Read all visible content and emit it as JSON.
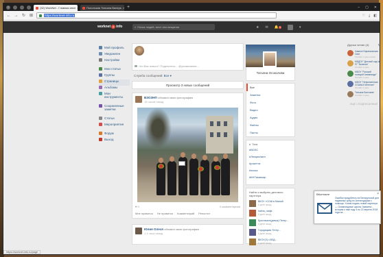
{
  "browser": {
    "tabs": [
      {
        "label": "(32) WorkNet - Главная инсп",
        "active": true
      },
      {
        "label": "Полонская Татьяна Валерь",
        "active": false
      }
    ],
    "url": "https://worknet-info.ru",
    "status_text": "https://worknet-info.ru/page"
  },
  "header": {
    "logo_text": "worknet",
    "logo_suffix": "info",
    "search_placeholder": "Поиск людей, мест или вещания",
    "notif_badge": "3"
  },
  "left_menu": [
    {
      "label": "Мой профиль",
      "icon": "user-icon",
      "color": "#5b7fa6"
    },
    {
      "label": "Уведомлен",
      "icon": "bell-icon",
      "color": "#6c8db1"
    },
    {
      "label": "Настройки",
      "icon": "gear-icon",
      "color": "#7a7a7a"
    },
    {
      "label": "Мои статьи",
      "icon": "article-icon",
      "color": "#4a8a4a"
    },
    {
      "label": "Группы",
      "icon": "group-icon",
      "color": "#5d6fa3"
    },
    {
      "label": "Страницы",
      "icon": "page-icon",
      "color": "#e2a23b",
      "selected": true
    },
    {
      "label": "Альбомы",
      "icon": "album-icon",
      "color": "#9a6bb3"
    },
    {
      "label": "Мои\nинструменты",
      "icon": "tools-icon",
      "color": "#4aa0a0",
      "tall": true
    },
    {
      "label": "Сохраненные\nзаметки",
      "icon": "notes-icon",
      "color": "#7653a8",
      "tall": true
    },
    {
      "label": "Статьи",
      "icon": "articles-icon",
      "color": "#888888"
    },
    {
      "label": "Мероприятия",
      "icon": "events-icon",
      "color": "#d24d4d"
    },
    {
      "label": "Форум",
      "icon": "forum-icon",
      "color": "#d87b2b"
    },
    {
      "label": "Выход",
      "icon": "exit-icon",
      "color": "#c0392b"
    }
  ],
  "composer": {
    "placeholder": "Что Вас нового? Поделитесь... @упоминание..."
  },
  "feed_filter": {
    "label": "Службa сообщений:",
    "value": "Все ▾"
  },
  "show_new": "Просмотр 3 новых сообщений",
  "post1": {
    "author": "ВЗОЗНП",
    "action": "обновил свою фотографию",
    "time": "16 часов назад",
    "likes": "0",
    "comments": "0 комментариев",
    "actions": [
      "Мне нравится",
      "Не нравится",
      "Комментарий",
      "Репостит"
    ]
  },
  "post2": {
    "author": "Юлия Олеся",
    "action": "обновил свою фотографию",
    "time": "1 4 часа назад"
  },
  "profile": {
    "name": "Татьяна Осоколова",
    "menu": [
      "Все",
      "Заметки",
      "Фото",
      "Видео",
      "Аудио",
      "Файлы",
      "Пасты"
    ],
    "tags_header": "Теги",
    "tags": [
      "#ВОЗС",
      "#Лекции/жел",
      "#рокетта",
      "#хоска",
      "#КНТиканкар"
    ],
    "partners_header": "Найти и выбрать делового партнера",
    "partners": [
      {
        "name": "ВКОУ «СОШ в Малый",
        "sub": "6 дней назад",
        "color": "#8a6a4a"
      },
      {
        "name": "halina_nadja",
        "sub": "6 дней назад",
        "color": "#b35a3a"
      },
      {
        "name": "Бриллиант(девса) Петер...",
        "sub": "6 дней назад",
        "color": "#3a8a5a"
      },
      {
        "name": "Городицкая Тетер...",
        "sub": "6 дней назад",
        "color": "#5a5a8a"
      },
      {
        "name": "ВКОУ(З) з ВЗД...",
        "sub": "6 дней назад",
        "color": "#a0783c"
      }
    ]
  },
  "friends": {
    "header": "Друзья читаю (4)",
    "list": [
      {
        "name": "Хамесе Биранковская Свят",
        "sub": "Онлайн 1 день назад",
        "color": "#c8643c"
      },
      {
        "name": "МБДОУ \"Детский сад № 97 \"Калинка\"",
        "sub": "Онлайн 1 день",
        "color": "#d7a24a"
      },
      {
        "name": "МБОУ \"Русский полицей олимпиаде\"",
        "sub": "Онлайн 1 день",
        "color": "#4a8a4a"
      },
      {
        "name": "МБОУ \"Непроменным СОШ№3 Метелин\"",
        "sub": "Онлайн 1 день",
        "color": "#5b6fa3"
      },
      {
        "name": "Татьяна Балтиеве",
        "sub": "Онлайн 1 день",
        "color": "#9a7a5a"
      }
    ],
    "more": "ЕЩЕ 1 ПОДПИСАННЫЙ"
  },
  "notification": {
    "title": "ВКонтакте",
    "body": "Ошибки придуйтесь на Беларусской для надежных сред по Антиподарам с помощи. Хотим подать новой партнера — Олимпиадные школы Экамена - которая к нам году 3 по 22 апреля 2018 года за..."
  }
}
